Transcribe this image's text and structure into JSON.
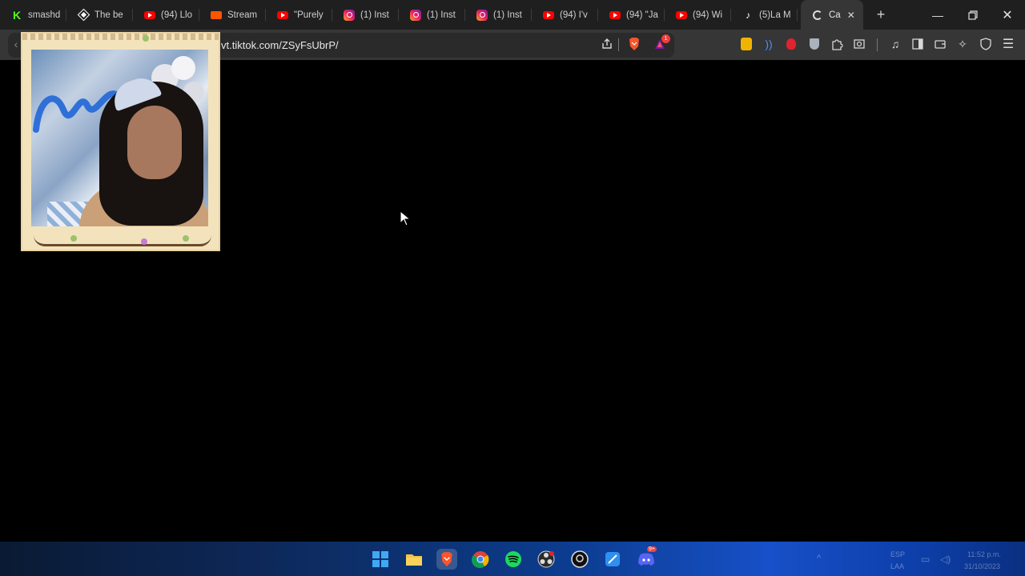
{
  "browser": {
    "tabs": [
      {
        "label": "smashd",
        "icon": "kick-icon"
      },
      {
        "label": "The be",
        "icon": "diamond-icon"
      },
      {
        "label": "(94) Llo",
        "icon": "youtube-icon"
      },
      {
        "label": "Stream",
        "icon": "soundcloud-icon"
      },
      {
        "label": "\"Purely",
        "icon": "youtube-icon"
      },
      {
        "label": "(1) Inst",
        "icon": "instagram-icon"
      },
      {
        "label": "(1) Inst",
        "icon": "instagram-icon"
      },
      {
        "label": "(1) Inst",
        "icon": "instagram-icon"
      },
      {
        "label": "(94) I'v",
        "icon": "youtube-icon"
      },
      {
        "label": "(94) \"Ja",
        "icon": "youtube-icon"
      },
      {
        "label": "(94) Wi",
        "icon": "youtube-icon"
      },
      {
        "label": "(5)La M",
        "icon": "tiktok-icon"
      }
    ],
    "active_tab": {
      "label": "Ca",
      "icon": "loading-spinner-icon"
    },
    "url": "vt.tiktok.com/ZSyFsUbrP/",
    "notification_count": "1"
  },
  "taskbar": {
    "apps": [
      "windows-start",
      "file-explorer",
      "brave",
      "chrome",
      "spotify",
      "obs",
      "camera",
      "snipping-tool",
      "discord"
    ],
    "discord_badge": "9+",
    "language": "ESP",
    "language_sub": "LAA",
    "time": "11:52 p.m.",
    "date": "31/10/2023"
  },
  "colors": {
    "tab_bg": "#1f1f1f",
    "toolbar_bg": "#363636",
    "page_bg": "#000000",
    "brave_orange": "#fb542b"
  }
}
